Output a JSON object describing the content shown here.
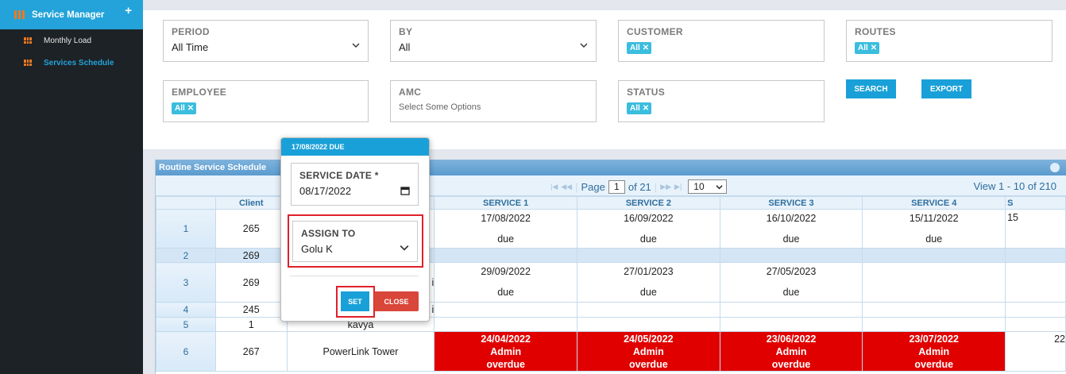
{
  "sidebar": {
    "title": "Service Manager",
    "plus_icon": "plus-icon",
    "items": [
      {
        "label": "Monthly Load",
        "active": false
      },
      {
        "label": "Services Schedule",
        "active": true
      }
    ]
  },
  "filters": {
    "period": {
      "label": "PERIOD",
      "value": "All Time"
    },
    "by": {
      "label": "BY",
      "value": "All"
    },
    "customer": {
      "label": "CUSTOMER",
      "chip": "All"
    },
    "routes": {
      "label": "ROUTES",
      "chip": "All"
    },
    "employee": {
      "label": "EMPLOYEE",
      "chip": "All"
    },
    "amc": {
      "label": "AMC",
      "placeholder": "Select Some Options"
    },
    "status": {
      "label": "STATUS",
      "chip": "All"
    },
    "search_label": "SEARCH",
    "export_label": "EXPORT"
  },
  "grid": {
    "title": "Routine Service Schedule",
    "pager": {
      "page_label": "Page",
      "page": "1",
      "of_label": "of 21",
      "rows_per_page": "10",
      "view_text": "View 1 - 10 of 210"
    },
    "columns": [
      "",
      "Client",
      "",
      "SERVICE 1",
      "SERVICE 2",
      "SERVICE 3",
      "SERVICE 4",
      "S"
    ],
    "rows": [
      {
        "n": "1",
        "client": "265",
        "name": "",
        "s1": [
          "17/08/2022",
          "due"
        ],
        "s2": [
          "16/09/2022",
          "due"
        ],
        "s3": [
          "16/10/2022",
          "due"
        ],
        "s4": [
          "15/11/2022",
          "due"
        ],
        "s5": "15"
      },
      {
        "n": "2",
        "client": "269",
        "name": "",
        "s1": [
          "",
          ""
        ],
        "s2": [
          "",
          ""
        ],
        "s3": [
          "",
          ""
        ],
        "s4": [
          "",
          ""
        ],
        "s5": ""
      },
      {
        "n": "3",
        "client": "269",
        "name": "i",
        "s1": [
          "29/09/2022",
          "due"
        ],
        "s2": [
          "27/01/2023",
          "due"
        ],
        "s3": [
          "27/05/2023",
          "due"
        ],
        "s4": [
          "",
          ""
        ],
        "s5": ""
      },
      {
        "n": "4",
        "client": "245",
        "name": "i",
        "s1": [
          "",
          ""
        ],
        "s2": [
          "",
          ""
        ],
        "s3": [
          "",
          ""
        ],
        "s4": [
          "",
          ""
        ],
        "s5": ""
      },
      {
        "n": "5",
        "client": "1",
        "name": "kavya",
        "s1": [
          "",
          ""
        ],
        "s2": [
          "",
          ""
        ],
        "s3": [
          "",
          ""
        ],
        "s4": [
          "",
          ""
        ],
        "s5": ""
      },
      {
        "n": "6",
        "client": "267",
        "name": "PowerLink Tower",
        "s1": [
          "24/04/2022",
          "Admin",
          "overdue"
        ],
        "s2": [
          "24/05/2022",
          "Admin",
          "overdue"
        ],
        "s3": [
          "23/06/2022",
          "Admin",
          "overdue"
        ],
        "s4": [
          "23/07/2022",
          "Admin",
          "overdue"
        ],
        "s5": "22"
      }
    ]
  },
  "popup": {
    "header": "17/08/2022 DUE",
    "service_date_label": "SERVICE DATE *",
    "service_date_value": "08/17/2022",
    "assign_to_label": "ASSIGN TO",
    "assign_to_value": "Golu K",
    "set_label": "SET",
    "close_label": "CLOSE"
  },
  "colors": {
    "accent": "#1aa0d8",
    "overdue": "#e00000",
    "close": "#d9463a",
    "highlight": "#e0202a"
  }
}
